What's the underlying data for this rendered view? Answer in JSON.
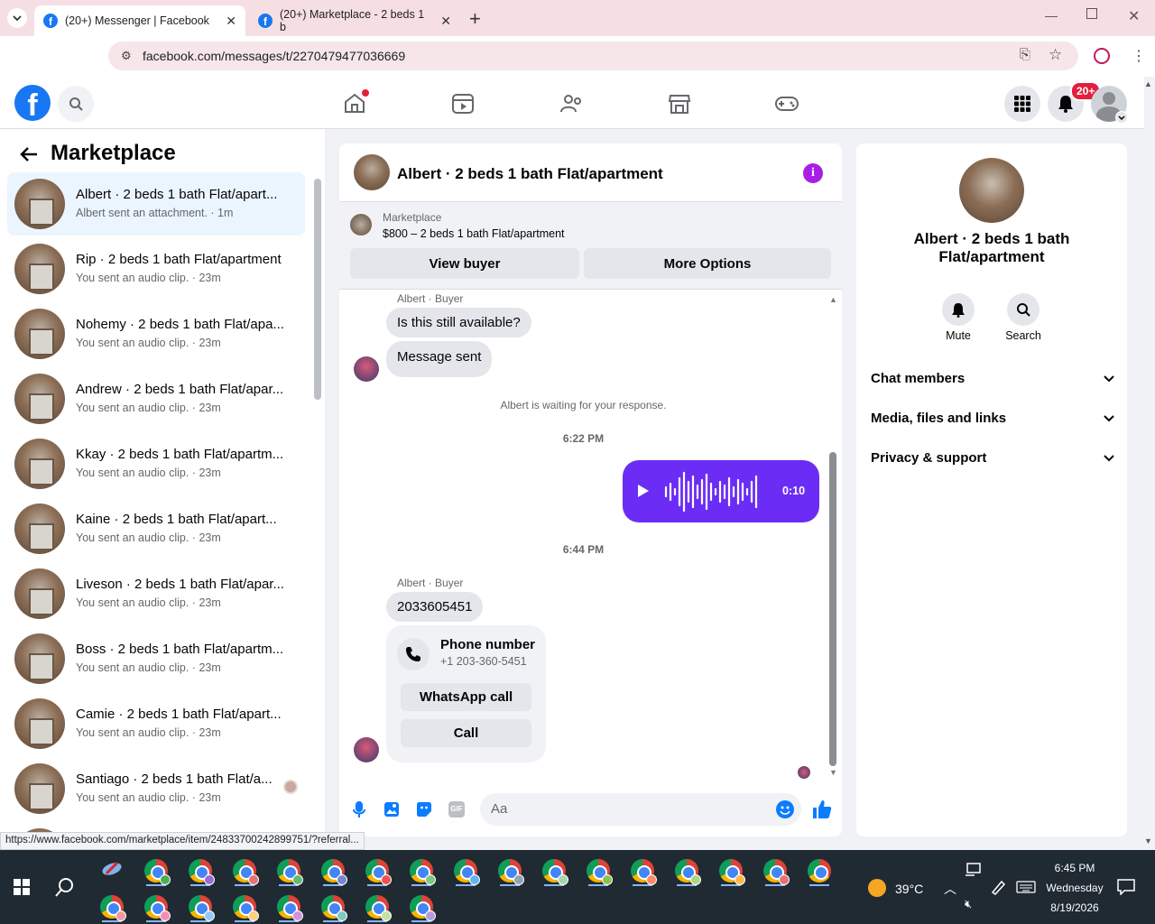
{
  "browser": {
    "tabs": [
      {
        "title": "(20+) Messenger | Facebook"
      },
      {
        "title": "(20+) Marketplace - 2 beds 1 b"
      }
    ],
    "url": "facebook.com/messages/t/2270479477036669",
    "status_url": "https://www.facebook.com/marketplace/item/24833700242899751/?referral..."
  },
  "fb_header": {
    "notification_badge": "20+"
  },
  "left_panel": {
    "title": "Marketplace",
    "conversations": [
      {
        "title": "Albert · 2 beds 1 bath Flat/apart...",
        "subtitle": "Albert sent an attachment. · 1m"
      },
      {
        "title": "Rip · 2 beds 1 bath Flat/apartment",
        "subtitle": "You sent an audio clip. · 23m"
      },
      {
        "title": "Nohemy · 2 beds 1 bath Flat/apa...",
        "subtitle": "You sent an audio clip. · 23m"
      },
      {
        "title": "Andrew · 2 beds 1 bath Flat/apar...",
        "subtitle": "You sent an audio clip. · 23m"
      },
      {
        "title": "Kkay · 2 beds 1 bath Flat/apartm...",
        "subtitle": "You sent an audio clip. · 23m"
      },
      {
        "title": "Kaine · 2 beds 1 bath Flat/apart...",
        "subtitle": "You sent an audio clip. · 23m"
      },
      {
        "title": "Liveson · 2 beds 1 bath Flat/apar...",
        "subtitle": "You sent an audio clip. · 23m"
      },
      {
        "title": "Boss · 2 beds 1 bath Flat/apartm...",
        "subtitle": "You sent an audio clip. · 23m"
      },
      {
        "title": "Camie · 2 beds 1 bath Flat/apart...",
        "subtitle": "You sent an audio clip. · 23m"
      },
      {
        "title": "Santiago · 2 beds 1 bath Flat/a...",
        "subtitle": "You sent an audio clip. · 23m"
      }
    ]
  },
  "chat": {
    "title": "Albert · 2 beds 1 bath Flat/apartment",
    "listing_label": "Marketplace",
    "listing_price": "$800 – 2 beds 1 bath Flat/apartment",
    "view_buyer": "View buyer",
    "more_options": "More Options",
    "sender1": "Albert · Buyer",
    "msg1": "Is this still available?",
    "msg2": "Message sent",
    "waiting": "Albert is waiting for your response.",
    "time1": "6:22 PM",
    "audio_duration": "0:10",
    "time2": "6:44 PM",
    "sender2": "Albert · Buyer",
    "msg3": "2033605451",
    "phone_title": "Phone number",
    "phone_number": "+1 203-360-5451",
    "whatsapp_call": "WhatsApp call",
    "call": "Call",
    "input_placeholder": "Aa"
  },
  "right_panel": {
    "name": "Albert · 2 beds 1 bath Flat/apartment",
    "mute": "Mute",
    "search": "Search",
    "sections": [
      "Chat members",
      "Media, files and links",
      "Privacy & support"
    ]
  },
  "taskbar": {
    "temperature": "39°C",
    "time": "6:45 PM",
    "day": "Wednesday",
    "date": "8/19/2026"
  },
  "colors": {
    "accent": "#1877f2",
    "audio_bubble": "#6b2df5",
    "info_icon": "#a81ee6",
    "badge_red": "#e41e3f"
  }
}
